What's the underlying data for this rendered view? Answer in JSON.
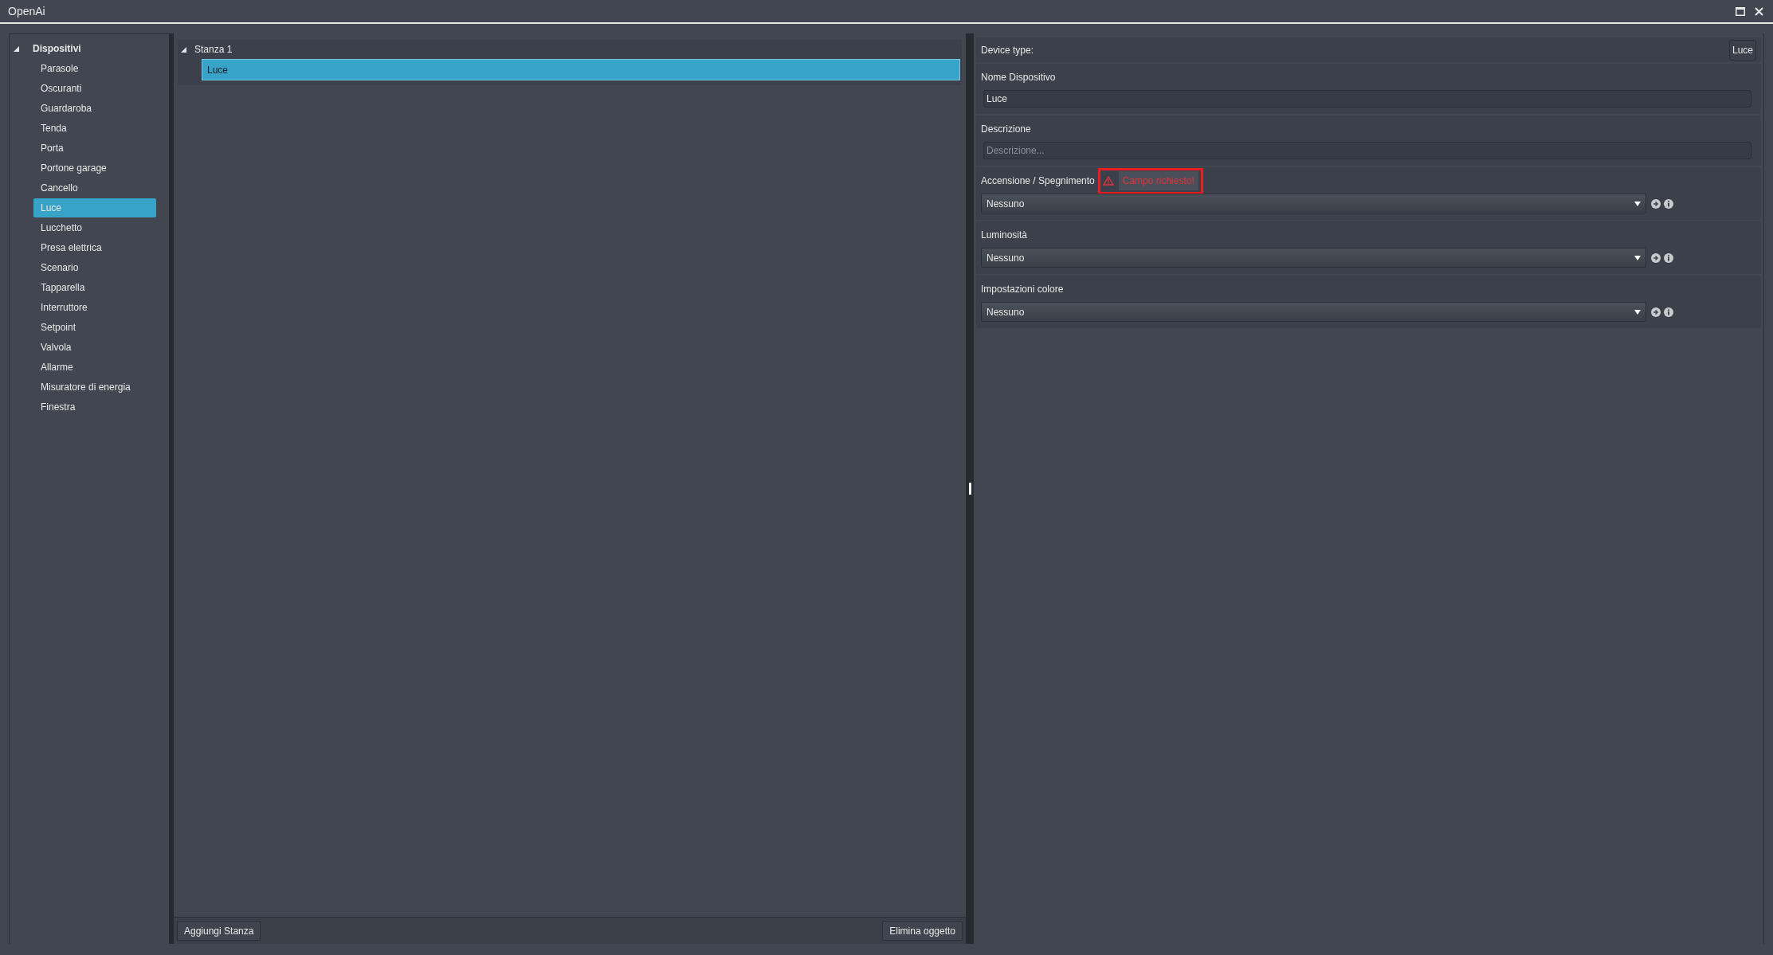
{
  "window": {
    "title": "OpenAi"
  },
  "device_tree": {
    "label": "Dispositivi",
    "expanded": true,
    "children": [
      {
        "label": "Parasole",
        "selected": false
      },
      {
        "label": "Oscuranti",
        "selected": false
      },
      {
        "label": "Guardaroba",
        "selected": false
      },
      {
        "label": "Tenda",
        "selected": false
      },
      {
        "label": "Porta",
        "selected": false
      },
      {
        "label": "Portone garage",
        "selected": false
      },
      {
        "label": "Cancello",
        "selected": false
      },
      {
        "label": "Luce",
        "selected": true
      },
      {
        "label": "Lucchetto",
        "selected": false
      },
      {
        "label": "Presa elettrica",
        "selected": false
      },
      {
        "label": "Scenario",
        "selected": false
      },
      {
        "label": "Tapparella",
        "selected": false
      },
      {
        "label": "Interruttore",
        "selected": false
      },
      {
        "label": "Setpoint",
        "selected": false
      },
      {
        "label": "Valvola",
        "selected": false
      },
      {
        "label": "Allarme",
        "selected": false
      },
      {
        "label": "Misuratore di energia",
        "selected": false
      },
      {
        "label": "Finestra",
        "selected": false
      }
    ]
  },
  "rooms": [
    {
      "label": "Stanza 1",
      "expanded": true,
      "children": [
        {
          "label": "Luce",
          "selected": true
        }
      ]
    }
  ],
  "room_buttons": [
    "Aggiungi Stanza",
    "Elimina oggetto"
  ],
  "properties": {
    "device_type": {
      "label": "Device type:",
      "value": "Luce"
    },
    "fields": [
      {
        "kind": "text",
        "label": "Nome Dispositivo",
        "value": "Luce"
      },
      {
        "kind": "text",
        "label": "Descrizione",
        "placeholder": "Descrizione..."
      },
      {
        "kind": "select",
        "label": "Accensione / Spegnimento",
        "value": "Nessuno",
        "error": "Campo richiesto!"
      },
      {
        "kind": "select",
        "label": "Luminosità",
        "value": "Nessuno"
      },
      {
        "kind": "select",
        "label": "Impostazioni colore",
        "value": "Nessuno"
      }
    ]
  }
}
